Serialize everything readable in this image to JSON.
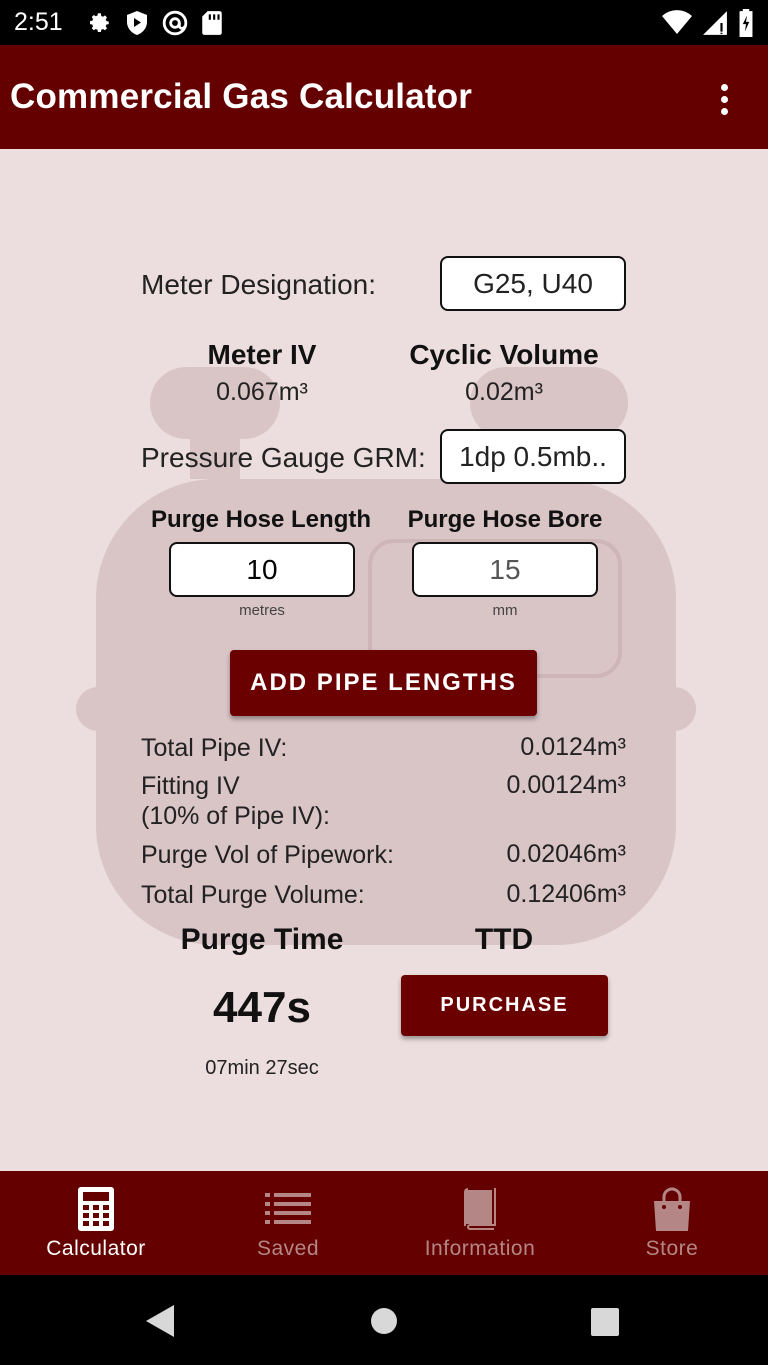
{
  "status_bar": {
    "time": "2:51"
  },
  "app_bar": {
    "title": "Commercial Gas Calculator"
  },
  "meter_designation": {
    "label": "Meter Designation:",
    "value": "G25, U40"
  },
  "meter_iv": {
    "label": "Meter IV",
    "value": "0.067m³"
  },
  "cyclic_volume": {
    "label": "Cyclic Volume",
    "value": "0.02m³"
  },
  "pressure_gauge": {
    "label": "Pressure Gauge GRM:",
    "value": "1dp 0.5mb.."
  },
  "hose_length": {
    "label": "Purge Hose Length",
    "value": "10",
    "unit": "metres"
  },
  "hose_bore": {
    "label": "Purge Hose Bore",
    "value": "15",
    "unit": "mm"
  },
  "add_pipe_button": "ADD PIPE LENGTHS",
  "results": {
    "total_pipe_iv": {
      "label": "Total Pipe IV:",
      "value": "0.0124m³"
    },
    "fitting_iv": {
      "label_line1": "Fitting IV",
      "label_line2": "(10% of Pipe IV):",
      "value": "0.00124m³"
    },
    "purge_vol_pipework": {
      "label": "Purge Vol of Pipework:",
      "value": "0.02046m³"
    },
    "total_purge_volume": {
      "label": "Total Purge Volume:",
      "value": "0.12406m³"
    }
  },
  "purge_time": {
    "label": "Purge Time",
    "value": "447s",
    "sub": "07min 27sec"
  },
  "ttd": {
    "label": "TTD",
    "button": "PURCHASE"
  },
  "bottom_nav": {
    "items": [
      {
        "label": "Calculator",
        "icon": "calculator-icon",
        "active": true
      },
      {
        "label": "Saved",
        "icon": "list-icon",
        "active": false
      },
      {
        "label": "Information",
        "icon": "book-icon",
        "active": false
      },
      {
        "label": "Store",
        "icon": "shopping-bag-icon",
        "active": false
      }
    ]
  },
  "colors": {
    "primary": "#640000",
    "background": "#ecdede",
    "watermark": "#d9c4c6",
    "inactive_nav": "#b48686"
  }
}
